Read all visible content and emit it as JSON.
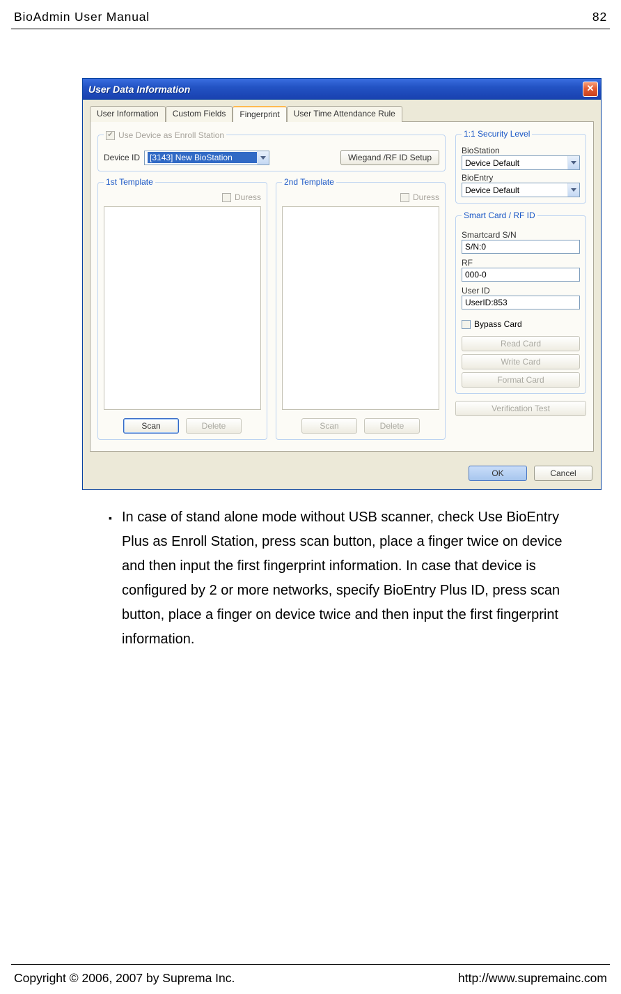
{
  "page_header": {
    "title": "BioAdmin User Manual",
    "page_no": "82"
  },
  "page_footer": {
    "copyright": "Copyright © 2006, 2007 by Suprema Inc.",
    "url": "http://www.supremainc.com"
  },
  "dialog": {
    "title": "User Data Information",
    "close_glyph": "✕",
    "tabs": [
      "User Information",
      "Custom Fields",
      "Fingerprint",
      "User Time Attendance Rule"
    ],
    "active_tab_index": 2,
    "enroll_group": {
      "legend_checkbox_label": "Use Device as Enroll Station",
      "checkbox_checked_glyph": "✔",
      "device_id_label": "Device ID",
      "device_combo_value": "[3143] New BioStation",
      "wiegand_button": "Wiegand /RF ID Setup"
    },
    "template1": {
      "legend": "1st Template",
      "duress_label": "Duress",
      "scan": "Scan",
      "delete": "Delete"
    },
    "template2": {
      "legend": "2nd Template",
      "duress_label": "Duress",
      "scan": "Scan",
      "delete": "Delete"
    },
    "security": {
      "legend": "1:1 Security Level",
      "biostation_label": "BioStation",
      "biostation_value": "Device Default",
      "bioentry_label": "BioEntry",
      "bioentry_value": "Device Default"
    },
    "smartcard": {
      "legend": "Smart Card / RF ID",
      "sn_label": "Smartcard S/N",
      "sn_value": "S/N:0",
      "rf_label": "RF",
      "rf_value": "000-0",
      "userid_label": "User ID",
      "userid_value": "UserID:853",
      "bypass_label": "Bypass Card",
      "read_btn": "Read Card",
      "write_btn": "Write Card",
      "format_btn": "Format Card"
    },
    "verification_btn": "Verification Test",
    "ok": "OK",
    "cancel": "Cancel"
  },
  "bullet_text": "In case of stand alone mode without USB scanner, check Use BioEntry Plus as Enroll Station, press scan button, place a finger twice on device and then input the first fingerprint information. In case that device is configured by 2 or more networks, specify BioEntry Plus ID, press scan button, place a finger on device twice and then input the first fingerprint information."
}
